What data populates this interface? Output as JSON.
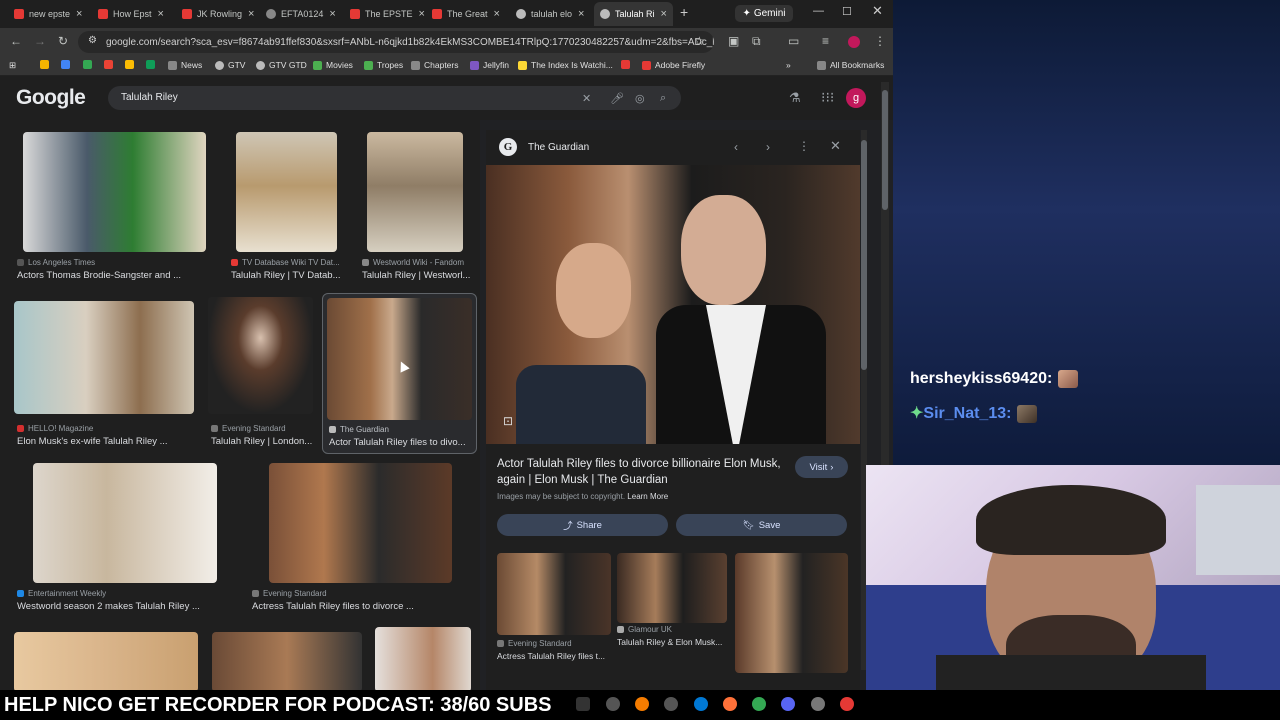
{
  "browser": {
    "tabs": [
      {
        "label": "new epste",
        "active": false
      },
      {
        "label": "How Epst",
        "active": false
      },
      {
        "label": "JK Rowling",
        "active": false
      },
      {
        "label": "EFTA0124",
        "active": false
      },
      {
        "label": "The EPSTE",
        "active": false
      },
      {
        "label": "The Great",
        "active": false
      },
      {
        "label": "talulah elo",
        "active": false
      },
      {
        "label": "Talulah Ri",
        "active": true
      }
    ],
    "new_tab": "+",
    "gemini_label": "Gemini",
    "url": "google.com/search?sca_esv=f8674ab91ffef830&sxsrf=ANbL-n6qjkd1b82k4EkMS3COMBE14TRlpQ:1770230482257&udm=2&fbs=ADc_l-aN...",
    "bookmarks": [
      {
        "label": ""
      },
      {
        "label": ""
      },
      {
        "label": ""
      },
      {
        "label": ""
      },
      {
        "label": ""
      },
      {
        "label": ""
      },
      {
        "label": "News"
      },
      {
        "label": "GTV"
      },
      {
        "label": "GTV GTD"
      },
      {
        "label": "Movies"
      },
      {
        "label": "Tropes"
      },
      {
        "label": "Chapters"
      },
      {
        "label": "Jellyfin"
      },
      {
        "label": "The Index Is Watchi..."
      },
      {
        "label": ""
      },
      {
        "label": "Adobe Firefly"
      }
    ],
    "all_bookmarks": "All Bookmarks"
  },
  "google": {
    "logo": "Google",
    "query": "Talulah Riley",
    "avatar_letter": "g"
  },
  "results": [
    {
      "source": "Los Angeles Times",
      "caption": "Actors Thomas Brodie-Sangster and ...",
      "color": "#5a6d7d"
    },
    {
      "source": "TV Database Wiki TV Dat...",
      "caption": "Talulah Riley | TV Datab...",
      "color": "#a08a6c"
    },
    {
      "source": "Westworld Wiki - Fandom",
      "caption": "Talulah Riley | Westworl...",
      "color": "#8a7560"
    },
    {
      "source": "HELLO! Magazine",
      "caption": "Elon Musk's ex-wife Talulah Riley ...",
      "color": "#8d7a66"
    },
    {
      "source": "Evening Standard",
      "caption": "Talulah Riley | London...",
      "color": "#3a3a3a"
    },
    {
      "source": "The Guardian",
      "caption": "Actor Talulah Riley files to divo...",
      "color": "#4a3a30"
    },
    {
      "source": "Entertainment Weekly",
      "caption": "Westworld season 2 makes Talulah Riley ...",
      "color": "#9a9290"
    },
    {
      "source": "Evening Standard",
      "caption": "Actress Talulah Riley files to divorce ...",
      "color": "#4e3a2e"
    }
  ],
  "panel": {
    "source": "The Guardian",
    "title": "Actor Talulah Riley files to divorce billionaire Elon Musk, again | Elon Musk | The Guardian",
    "copyright": "Images may be subject to copyright.",
    "learn_more": "Learn More",
    "visit": "Visit",
    "share": "Share",
    "save": "Save",
    "related": [
      {
        "source": "Evening Standard",
        "caption": "Actress Talulah Riley files t..."
      },
      {
        "source": "Glamour UK",
        "caption": "Talulah Riley & Elon Musk..."
      },
      {
        "source": "",
        "caption": ""
      }
    ]
  },
  "chat": [
    {
      "user": "hersheykiss69420:",
      "color": "#ffffff"
    },
    {
      "user": "Sir_Nat_13:",
      "color": "#5b8def"
    }
  ],
  "banner": "HELP NICO GET RECORDER FOR PODCAST: 38/60 SUBS"
}
